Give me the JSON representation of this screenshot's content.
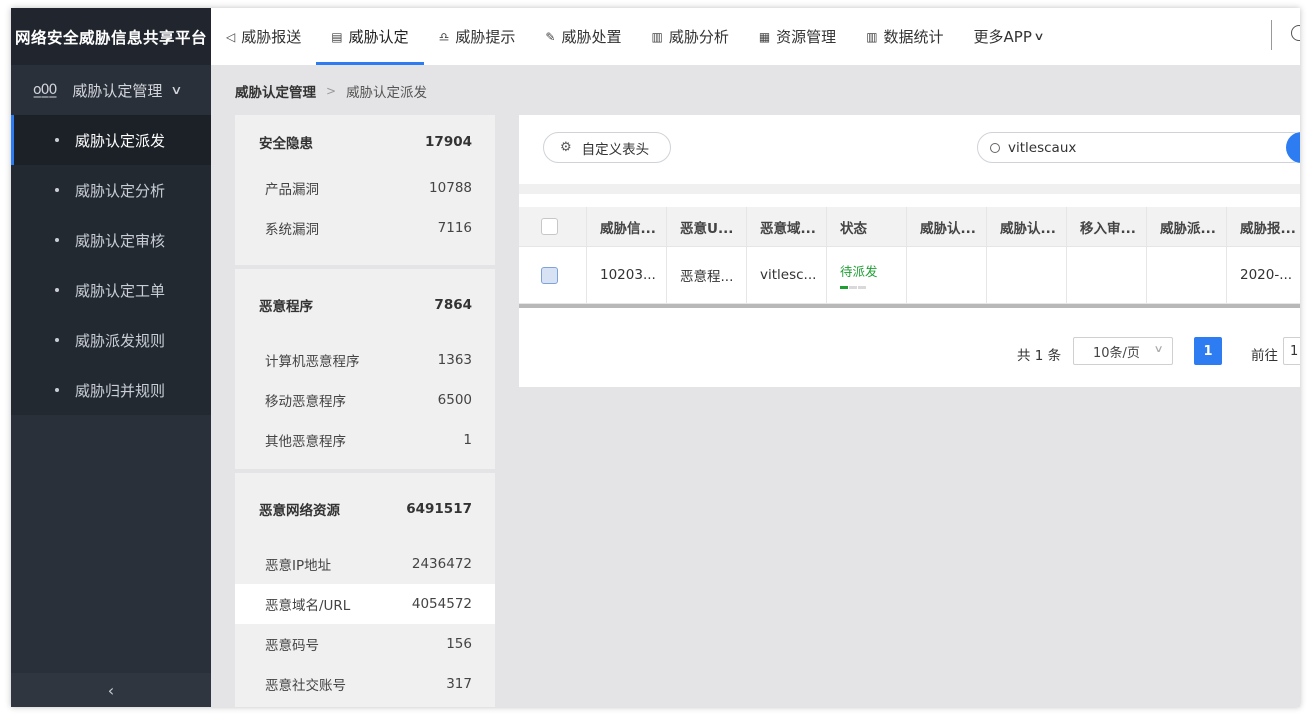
{
  "app": {
    "title": "网络安全威胁信息共享平台"
  },
  "topnav": {
    "tabs": [
      {
        "icon": "◁",
        "label": "威胁报送"
      },
      {
        "icon": "▤",
        "label": "威胁认定"
      },
      {
        "icon": "♎",
        "label": "威胁提示"
      },
      {
        "icon": "✎",
        "label": "威胁处置"
      },
      {
        "icon": "▥",
        "label": "威胁分析"
      },
      {
        "icon": "▦",
        "label": "资源管理"
      },
      {
        "icon": "▥",
        "label": "数据统计"
      }
    ],
    "more_label": "更多APP",
    "active_tab": "威胁认定"
  },
  "sidebar": {
    "section_label": "威胁认定管理",
    "items": [
      {
        "label": "威胁认定派发"
      },
      {
        "label": "威胁认定分析"
      },
      {
        "label": "威胁认定审核"
      },
      {
        "label": "威胁认定工单"
      },
      {
        "label": "威胁派发规则"
      },
      {
        "label": "威胁归并规则"
      }
    ],
    "collapse_glyph": "‹"
  },
  "breadcrumb": {
    "parent": "威胁认定管理",
    "separator": ">",
    "current": "威胁认定派发"
  },
  "stats": {
    "security": {
      "title": "安全隐患",
      "total": "17904",
      "rows": [
        {
          "label": "产品漏洞",
          "value": "10788"
        },
        {
          "label": "系统漏洞",
          "value": "7116"
        }
      ]
    },
    "malware": {
      "title": "恶意程序",
      "total": "7864",
      "rows": [
        {
          "label": "计算机恶意程序",
          "value": "1363"
        },
        {
          "label": "移动恶意程序",
          "value": "6500"
        },
        {
          "label": "其他恶意程序",
          "value": "1"
        }
      ]
    },
    "network": {
      "title": "恶意网络资源",
      "total": "6491517",
      "rows": [
        {
          "label": "恶意IP地址",
          "value": "2436472"
        },
        {
          "label": "恶意域名/URL",
          "value": "4054572"
        },
        {
          "label": "恶意码号",
          "value": "156"
        },
        {
          "label": "恶意社交账号",
          "value": "317"
        }
      ]
    }
  },
  "toolbar": {
    "custom_header_label": "自定义表头",
    "search_value": "vitlescaux"
  },
  "table": {
    "headers": [
      "威胁信...",
      "恶意U...",
      "恶意域...",
      "状态",
      "威胁认...",
      "威胁认...",
      "移入审...",
      "威胁派...",
      "威胁报..."
    ],
    "rows": [
      {
        "c1": "10203...",
        "c2": "恶意程...",
        "c3": "vitlesc...",
        "status": "待派发",
        "c5": "",
        "c6": "",
        "c7": "",
        "c8": "",
        "c9": "2020-..."
      }
    ],
    "status_color": "#1f9f33"
  },
  "pagination": {
    "total_label": "共 1 条",
    "page_size": "10条/页",
    "current_page": "1",
    "goto_label": "前往",
    "goto_value": "1"
  },
  "colors": {
    "accent": "#2d7cf2",
    "sidebar_bg": "#2a3039",
    "status_green": "#1f9f33"
  }
}
